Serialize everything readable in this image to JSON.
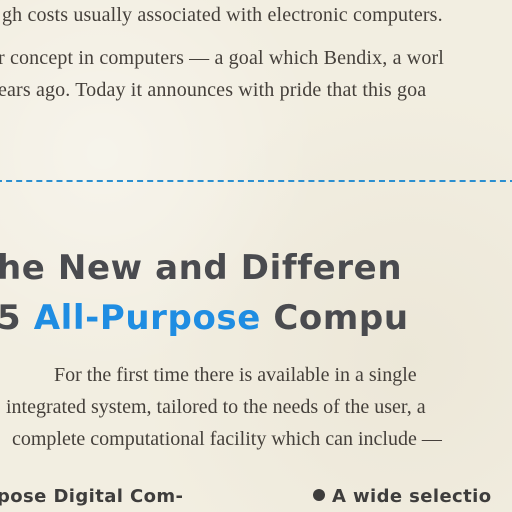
{
  "top_paragraph": {
    "lines": [
      "gh costs usually associated with electronic computers.",
      "r concept in computers — a goal which Bendix, a worl",
      "ears ago. Today it announces with pride that this goa"
    ]
  },
  "headline": {
    "line1": "he New and Differen",
    "line2_prefix": "5 ",
    "line2_blue": "All-Purpose",
    "line2_rest": " Compu"
  },
  "intro": {
    "lines": [
      "For the first time there is available in a single",
      "integrated system, tailored to the needs of the user, a",
      "complete computational facility which can include —"
    ]
  },
  "bullets": {
    "left": "pose Digital Com-",
    "right": "A wide selectio",
    "right_bullet_icon": "bullet-dot-icon"
  },
  "colors": {
    "paper": "#f2eee1",
    "text": "#45403b",
    "headline_gray": "#4a4b4f",
    "accent_blue": "#1f8de2",
    "dash_blue": "#2a8fd0"
  }
}
